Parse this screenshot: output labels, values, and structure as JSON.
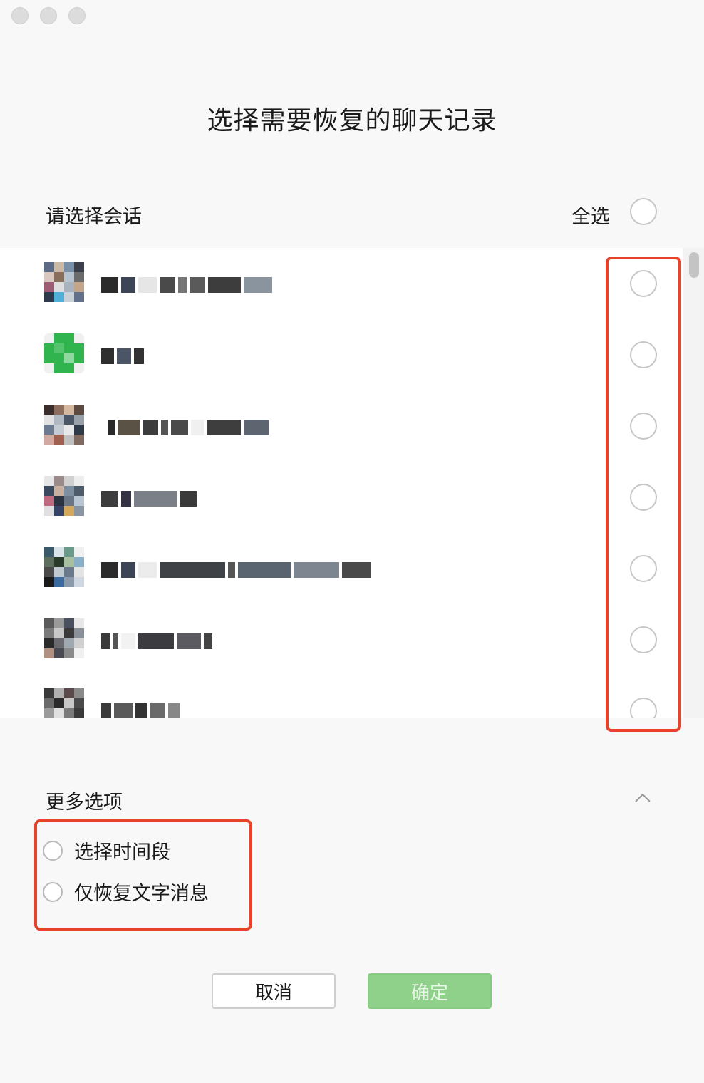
{
  "window": {
    "controls": [
      "close",
      "minimize",
      "zoom"
    ]
  },
  "dialog": {
    "title": "选择需要恢复的聊天记录"
  },
  "sessions": {
    "label": "请选择会话",
    "select_all_label": "全选",
    "items": [
      {
        "avatar": "group-avatar",
        "name": "(obscured)",
        "selected": false
      },
      {
        "avatar": "green-avatar",
        "name": "(obscured)",
        "selected": false
      },
      {
        "avatar": "group-avatar",
        "name": "(obscured)",
        "selected": false
      },
      {
        "avatar": "group-avatar",
        "name": "(obscured)",
        "selected": false
      },
      {
        "avatar": "group-avatar",
        "name": "(obscured)",
        "selected": false
      },
      {
        "avatar": "group-avatar",
        "name": "(obscured)",
        "selected": false
      },
      {
        "avatar": "group-avatar",
        "name": "(obscured)",
        "selected": false
      }
    ]
  },
  "more_options": {
    "label": "更多选项",
    "expanded": true,
    "options": [
      {
        "label": "选择时间段",
        "checked": false
      },
      {
        "label": "仅恢复文字消息",
        "checked": false
      }
    ]
  },
  "buttons": {
    "cancel": "取消",
    "confirm": "确定"
  },
  "colors": {
    "highlight": "#e8412c",
    "confirm_bg": "#8fd18a",
    "background": "#f8f8f8"
  }
}
